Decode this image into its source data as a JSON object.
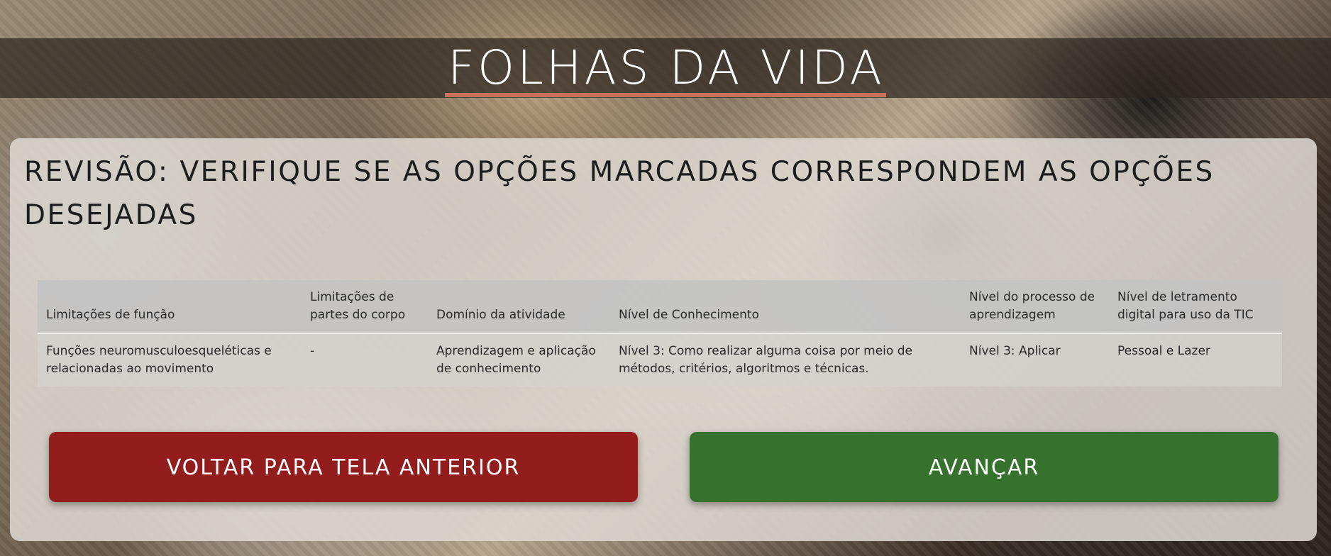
{
  "header": {
    "title": "FOLHAS DA VIDA"
  },
  "review": {
    "heading": "REVISÃO: VERIFIQUE SE AS OPÇÕES MARCADAS CORRESPONDEM AS OPÇÕES DESEJADAS",
    "columns": [
      "Limitações de função",
      "Limitações de partes do corpo",
      "Domínio da atividade",
      "Nível de Conhecimento",
      "Nível do processo de aprendizagem",
      "Nível de letramento digital para uso da TIC"
    ],
    "rows": [
      [
        "Funções neuromusculoesqueléticas e relacionadas ao movimento",
        "-",
        "Aprendizagem e aplicação de conhecimento",
        "Nível 3: Como realizar alguma coisa por meio de métodos, critérios, algoritmos e técnicas.",
        "Nível 3: Aplicar",
        "Pessoal e Lazer"
      ]
    ]
  },
  "actions": {
    "back_label": "VOLTAR PARA TELA ANTERIOR",
    "next_label": "AVANÇAR",
    "back_color": "#931d1d",
    "next_color": "#37712e"
  },
  "colors": {
    "title_underline": "#c9705a"
  }
}
